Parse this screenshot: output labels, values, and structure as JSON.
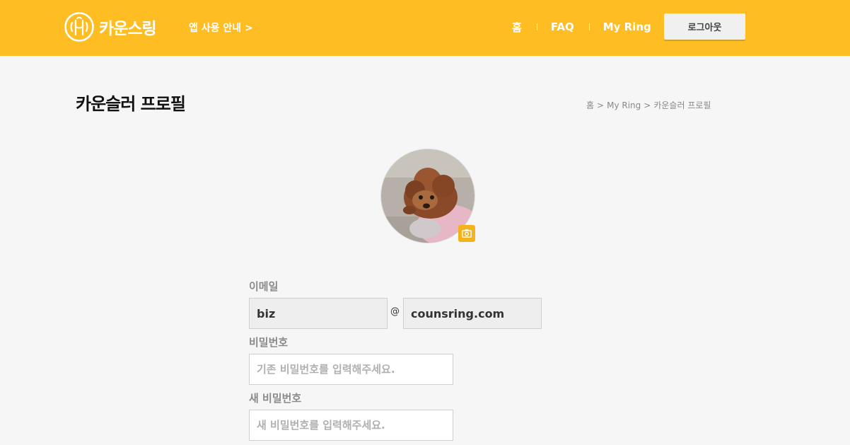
{
  "header": {
    "logo_text": "카운스링",
    "guide_link": "앱 사용 안내 >",
    "nav": [
      "홈",
      "FAQ",
      "My Ring"
    ],
    "logout": "로그아웃",
    "bg_color": "#febd22"
  },
  "page": {
    "title": "카운슬러 프로필",
    "breadcrumb": [
      "홈",
      "My Ring",
      "카운슬러 프로필"
    ]
  },
  "profile": {
    "avatar_alt": "poodle-photo",
    "camera_icon": "camera-icon"
  },
  "form": {
    "email_label": "이메일",
    "email_local": "biz",
    "at": "@",
    "email_domain": "counsring.com",
    "password_label": "비밀번호",
    "password_placeholder": "기존 비밀번호를 입력해주세요.",
    "new_password_label": "새 비밀번호",
    "new_password_placeholder": "새 비밀번호를 입력해주세요."
  }
}
